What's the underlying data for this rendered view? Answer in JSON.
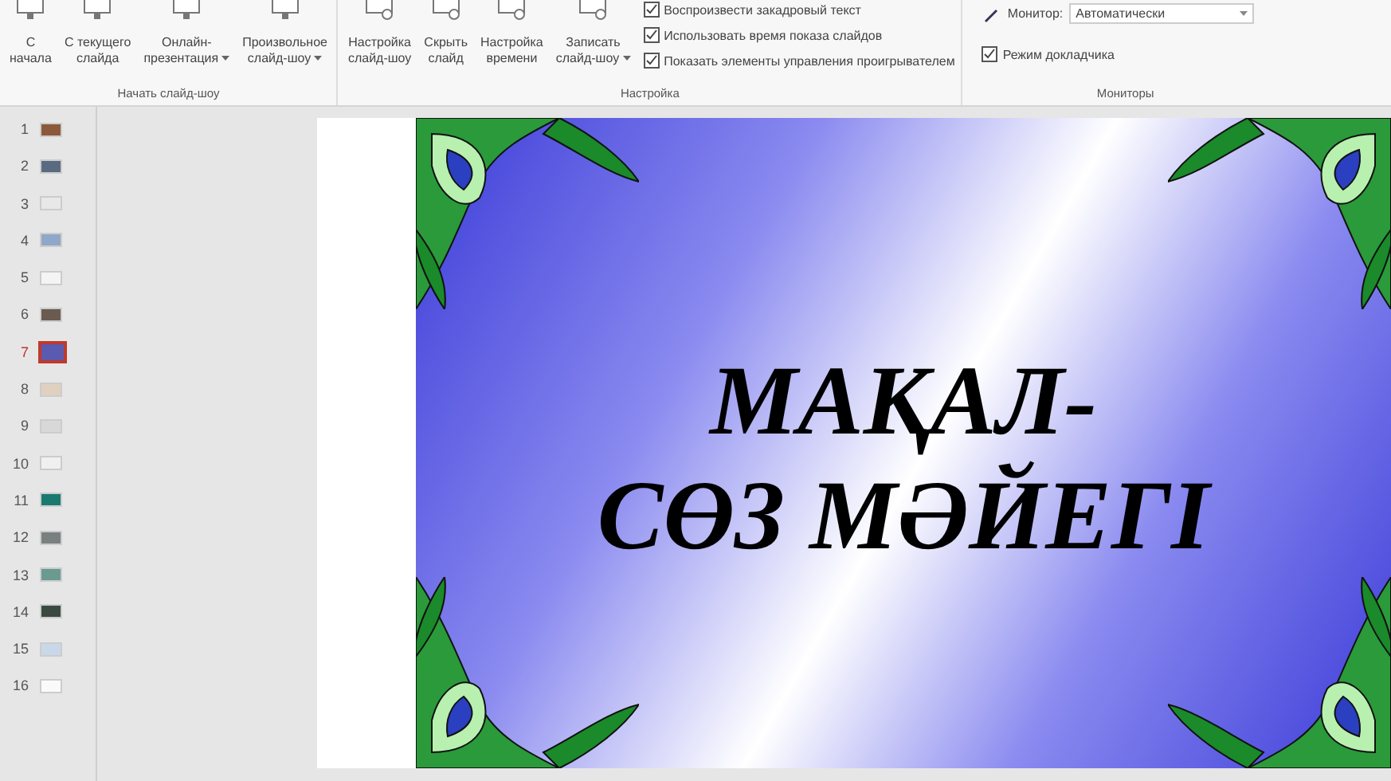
{
  "ribbon": {
    "groups": [
      {
        "label": "Начать слайд-шоу",
        "buttons": [
          {
            "line1": "С",
            "line2": "начала",
            "dropdown": false
          },
          {
            "line1": "С текущего",
            "line2": "слайда",
            "dropdown": false
          },
          {
            "line1": "Онлайн-",
            "line2": "презентация",
            "dropdown": true
          },
          {
            "line1": "Произвольное",
            "line2": "слайд-шоу",
            "dropdown": true
          }
        ]
      },
      {
        "label": "Настройка",
        "buttons": [
          {
            "line1": "Настройка",
            "line2": "слайд-шоу",
            "dropdown": false
          },
          {
            "line1": "Скрыть",
            "line2": "слайд",
            "dropdown": false
          },
          {
            "line1": "Настройка",
            "line2": "времени",
            "dropdown": false
          },
          {
            "line1": "Записать",
            "line2": "слайд-шоу",
            "dropdown": true
          }
        ],
        "checkboxes": [
          {
            "label": "Воспроизвести закадровый текст",
            "checked": true
          },
          {
            "label": "Использовать время показа слайдов",
            "checked": true
          },
          {
            "label": "Показать элементы управления проигрывателем",
            "checked": true
          }
        ]
      },
      {
        "label": "Мониторы",
        "monitor_label": "Монитор:",
        "monitor_value": "Автоматически",
        "checkboxes": [
          {
            "label": "Режим докладчика",
            "checked": true
          }
        ]
      }
    ]
  },
  "thumbnails": [
    {
      "number": "1",
      "color": "#8a5a3a",
      "selected": false
    },
    {
      "number": "2",
      "color": "#5a6a80",
      "selected": false
    },
    {
      "number": "3",
      "color": "#e8e8e8",
      "selected": false
    },
    {
      "number": "4",
      "color": "#8fa8c8",
      "selected": false
    },
    {
      "number": "5",
      "color": "#f4f4f4",
      "selected": false
    },
    {
      "number": "6",
      "color": "#6a5a50",
      "selected": false
    },
    {
      "number": "7",
      "color": "#5a5ab0",
      "selected": true
    },
    {
      "number": "8",
      "color": "#e0d0c0",
      "selected": false
    },
    {
      "number": "9",
      "color": "#d8d8d8",
      "selected": false
    },
    {
      "number": "10",
      "color": "#f0f0f0",
      "selected": false
    },
    {
      "number": "11",
      "color": "#1a7a70",
      "selected": false
    },
    {
      "number": "12",
      "color": "#7a8080",
      "selected": false
    },
    {
      "number": "13",
      "color": "#6a9a90",
      "selected": false
    },
    {
      "number": "14",
      "color": "#3a4a40",
      "selected": false
    },
    {
      "number": "15",
      "color": "#c8d8e8",
      "selected": false
    },
    {
      "number": "16",
      "color": "#fafafa",
      "selected": false
    }
  ],
  "slide": {
    "title_line1": "МАҚАЛ-",
    "title_line2": "СӨЗ МӘЙЕГІ"
  }
}
